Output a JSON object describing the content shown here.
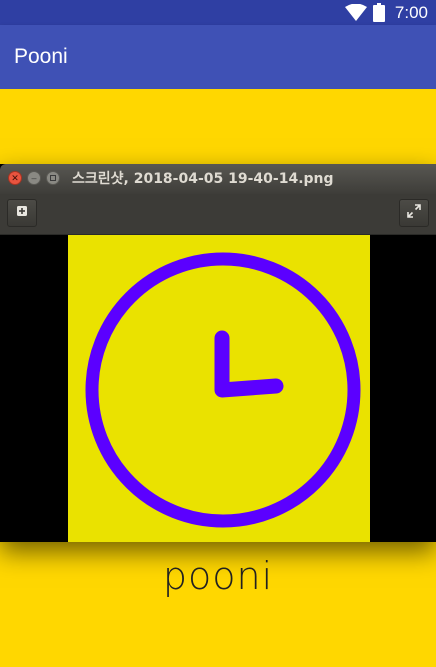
{
  "status_bar": {
    "time": "7:00",
    "icons": [
      "wifi-icon",
      "battery-icon"
    ],
    "background": "#2F3FA3"
  },
  "app_bar": {
    "title": "Pooni",
    "background": "#3F51B5"
  },
  "app_content": {
    "background": "#FFD700",
    "label": "pooni"
  },
  "viewer": {
    "title": "스크린샷, 2018-04-05 19-40-14.png",
    "window_buttons": [
      "close-icon",
      "minimize-icon",
      "maximize-icon"
    ],
    "toolbar": {
      "left_icon": "add-icon",
      "right_icon": "fullscreen-icon"
    },
    "image": {
      "subject": "clock-icon",
      "background": "#EAE200",
      "stroke_color": "#5B00FF"
    }
  }
}
